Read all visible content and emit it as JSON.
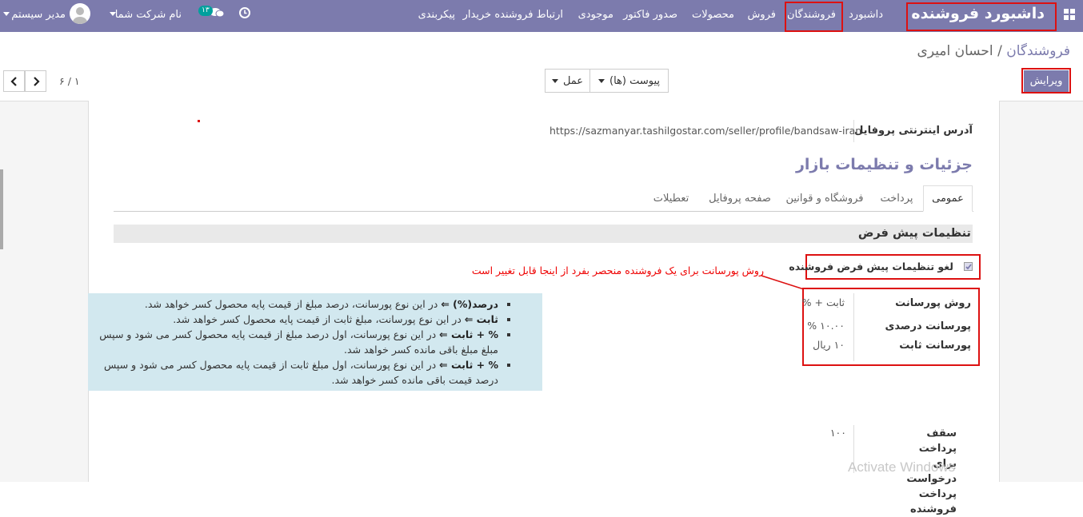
{
  "navbar": {
    "title": "داشبورد فروشنده",
    "menu": [
      "داشبورد",
      "فروشندگان",
      "فروش",
      "محصولات",
      "صدور فاکتور",
      "موجودی",
      "ارتباط فروشنده خریدار",
      "پیکربندی"
    ],
    "company": "نام شرکت شما",
    "chat_badge": "۱۳",
    "user": "مدیر سیستم"
  },
  "breadcrumb": {
    "parent": "فروشندگان",
    "separator": "/",
    "current": "احسان امیری"
  },
  "toolbar": {
    "edit_label": "ویرایش",
    "attachments_label": "پیوست (ها)",
    "action_label": "عمل",
    "pager": "۱ / ۶"
  },
  "form": {
    "profile_url_label": "آدرس اینترنتی پروفایل",
    "profile_url": "https://sazmanyar.tashilgostar.com/seller/profile/bandsaw-iran",
    "section_title": "جزئیات و تنظیمات بازار",
    "tabs": [
      "عمومی",
      "پرداخت",
      "فروشگاه و قوانین",
      "صفحه پروفایل",
      "تعطیلات"
    ],
    "defaults_header": "تنظیمات پیش فرض",
    "override_label": "لغو تنظیمات پیش فرض فروشنده",
    "annotation": "روش پورسانت برای یک فروشنده منحصر بفرد از اینجا قابل تغییر است",
    "commission_method_label": "روش پورسانت",
    "commission_method_value": "ثابت + %",
    "commission_percent_label": "پورسانت درصدی",
    "commission_percent_value": "۱۰.۰۰ %",
    "commission_fixed_label": "پورسانت ثابت",
    "commission_fixed_value": "۱۰ ریال",
    "payout_limit_label": "سقف پرداخت برای درخواست پرداخت فروشنده",
    "payout_limit_value": "۱۰۰"
  },
  "info_box": [
    {
      "bold": "درصد(%) ⇐",
      "text": " در این نوع پورسانت، درصد مبلغ از قیمت پایه محصول کسر خواهد شد."
    },
    {
      "bold": "ثابت ⇐",
      "text": " در این نوع پورسانت، مبلغ ثابت از قیمت پایه محصول کسر خواهد شد."
    },
    {
      "bold": "% + ثابت ⇐",
      "text": " در این نوع پورسانت، اول درصد مبلغ از قیمت پایه محصول کسر می شود و سپس مبلغ مبلغ باقی مانده کسر خواهد شد."
    },
    {
      "bold": "% + ثابت ⇐",
      "text": " در این نوع پورسانت، اول مبلغ ثابت از قیمت پایه محصول کسر می شود و سپس درصد قیمت باقی مانده کسر خواهد شد."
    }
  ],
  "watermark": "Activate Windows",
  "colors": {
    "navbar": "#7c7bad",
    "highlight": "#dd1111",
    "info_bg": "#d2e8ef"
  }
}
